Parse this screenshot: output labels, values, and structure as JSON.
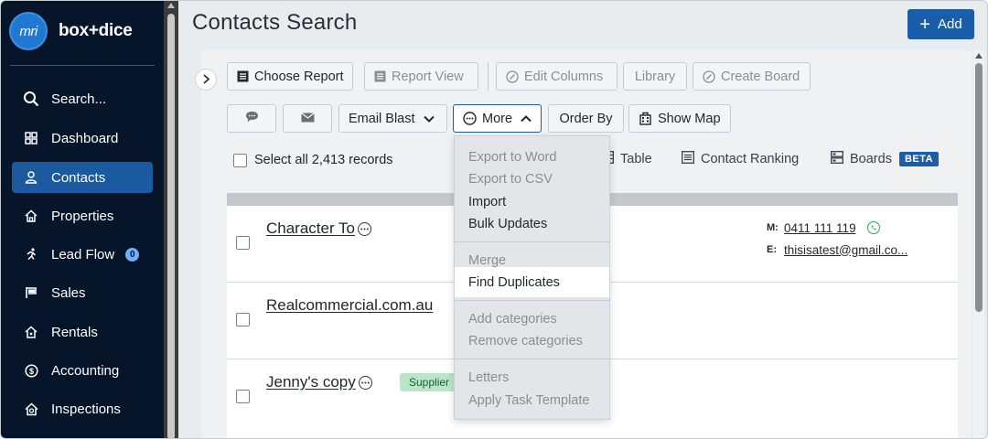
{
  "brand": {
    "logo_text": "mri",
    "name": "box+dice"
  },
  "sidebar": {
    "items": [
      {
        "label": "Search..."
      },
      {
        "label": "Dashboard"
      },
      {
        "label": "Contacts"
      },
      {
        "label": "Properties"
      },
      {
        "label": "Lead Flow",
        "badge": "0"
      },
      {
        "label": "Sales"
      },
      {
        "label": "Rentals"
      },
      {
        "label": "Accounting"
      },
      {
        "label": "Inspections"
      }
    ]
  },
  "header": {
    "title": "Contacts Search",
    "add_label": "Add"
  },
  "toolbar": {
    "choose_report": "Choose Report",
    "report_view": "Report View",
    "edit_columns": "Edit Columns",
    "library": "Library",
    "create_board": "Create Board",
    "email_blast": "Email Blast",
    "more": "More",
    "order_by": "Order By",
    "show_map": "Show Map"
  },
  "selection": {
    "select_all": "Select all 2,413 records"
  },
  "views": {
    "table": "Table",
    "contact_ranking": "Contact Ranking",
    "boards": "Boards",
    "beta": "BETA"
  },
  "more_menu": {
    "export_word": "Export to Word",
    "export_csv": "Export to CSV",
    "import": "Import",
    "bulk_updates": "Bulk Updates",
    "merge": "Merge",
    "find_duplicates": "Find Duplicates",
    "add_categories": "Add categories",
    "remove_categories": "Remove categories",
    "letters": "Letters",
    "apply_task_template": "Apply Task Template"
  },
  "contacts": [
    {
      "name": "Character To",
      "mobile_label": "M:",
      "mobile": "0411 111 119",
      "email_label": "E:",
      "email": "thisisatest@gmail.co..."
    },
    {
      "name": "Realcommercial.com.au"
    },
    {
      "name": "Jenny's copy",
      "tag": "Supplier"
    }
  ]
}
